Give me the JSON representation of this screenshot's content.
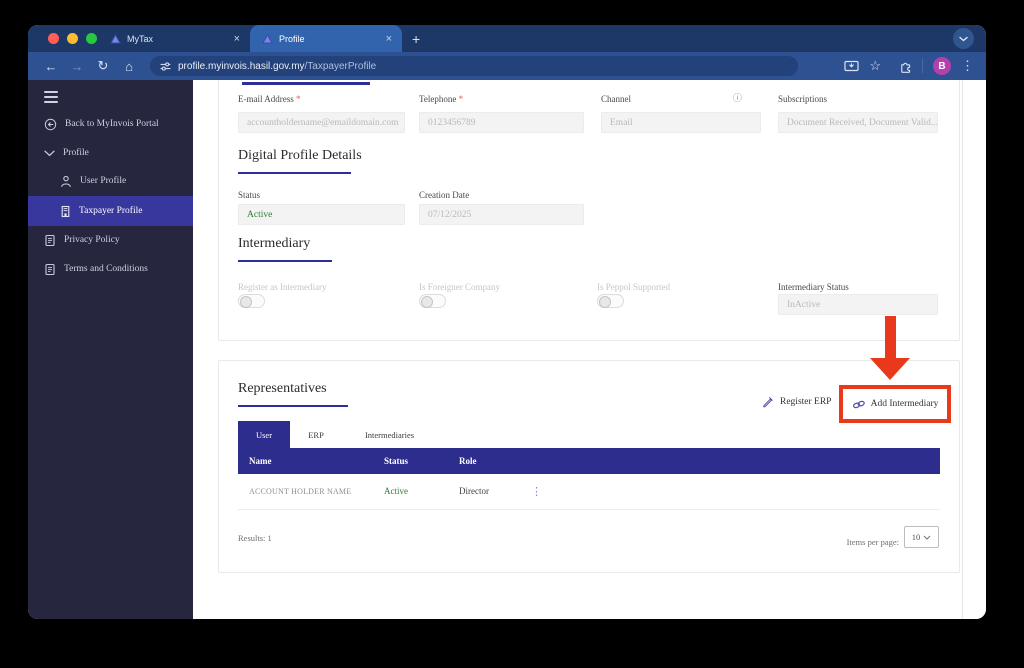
{
  "colors": {
    "accent_navy": "#2d2d8e",
    "heading_underline": "#2d2d9e",
    "sidebar_bg": "#26263f",
    "sidebar_active_bg": "#37379e",
    "annotation_red": "#e8391c",
    "status_green": "#2e7d32",
    "chrome_tabbar": "#1d3866",
    "chrome_toolbar": "#2e5191",
    "avatar_purple": "#b43fae"
  },
  "icons": {
    "close": "×",
    "new_tab": "+",
    "back": "←",
    "forward": "→",
    "reload": "↻",
    "home": "⌂",
    "star": "☆",
    "kebab": "⋮",
    "row_kebab": "⋮",
    "info": "ⓘ"
  },
  "browser": {
    "tabs": [
      {
        "title": "MyTax"
      },
      {
        "title": "Profile"
      }
    ],
    "url_host": "profile.myinvois.hasil.gov.my",
    "url_path": "/TaxpayerProfile",
    "avatar_letter": "B"
  },
  "sidebar": {
    "back_to_portal": "Back to MyInvois Portal",
    "profile_group": "Profile",
    "user_profile": "User Profile",
    "taxpayer_profile": "Taxpayer Profile",
    "privacy_policy": "Privacy Policy",
    "terms": "Terms and Conditions"
  },
  "contact": {
    "required_mark": "*",
    "email_label": "E-mail Address",
    "email_value": "accountholdername@emaildomain.com",
    "telephone_label": "Telephone",
    "telephone_value": "0123456789",
    "channel_label": "Channel",
    "channel_placeholder": "Email",
    "subscriptions_label": "Subscriptions",
    "subscriptions_value": "Document Received, Document Valid..."
  },
  "digital_profile": {
    "title": "Digital Profile Details",
    "status_label": "Status",
    "status_value": "Active",
    "creation_label": "Creation Date",
    "creation_value": "07/12/2025"
  },
  "intermediary": {
    "title": "Intermediary",
    "register_label": "Register as Intermediary",
    "foreigner_label": "Is Foreigner Company",
    "peppol_label": "Is Peppol Supported",
    "status_label": "Intermediary Status",
    "status_value": "InActive"
  },
  "representatives": {
    "title": "Representatives",
    "register_erp_label": "Register ERP",
    "add_intermediary_label": "Add Intermediary",
    "tabs": [
      {
        "label": "User"
      },
      {
        "label": "ERP"
      },
      {
        "label": "Intermediaries"
      }
    ],
    "table": {
      "headers": [
        {
          "label": "Name"
        },
        {
          "label": "Status"
        },
        {
          "label": "Role"
        }
      ],
      "rows": [
        {
          "name": "ACCOUNT HOLDER NAME",
          "status": "Active",
          "role": "Director"
        }
      ]
    },
    "results": "Results: 1",
    "items_per_page_label": "Items per page:",
    "items_per_page_value": "10"
  }
}
